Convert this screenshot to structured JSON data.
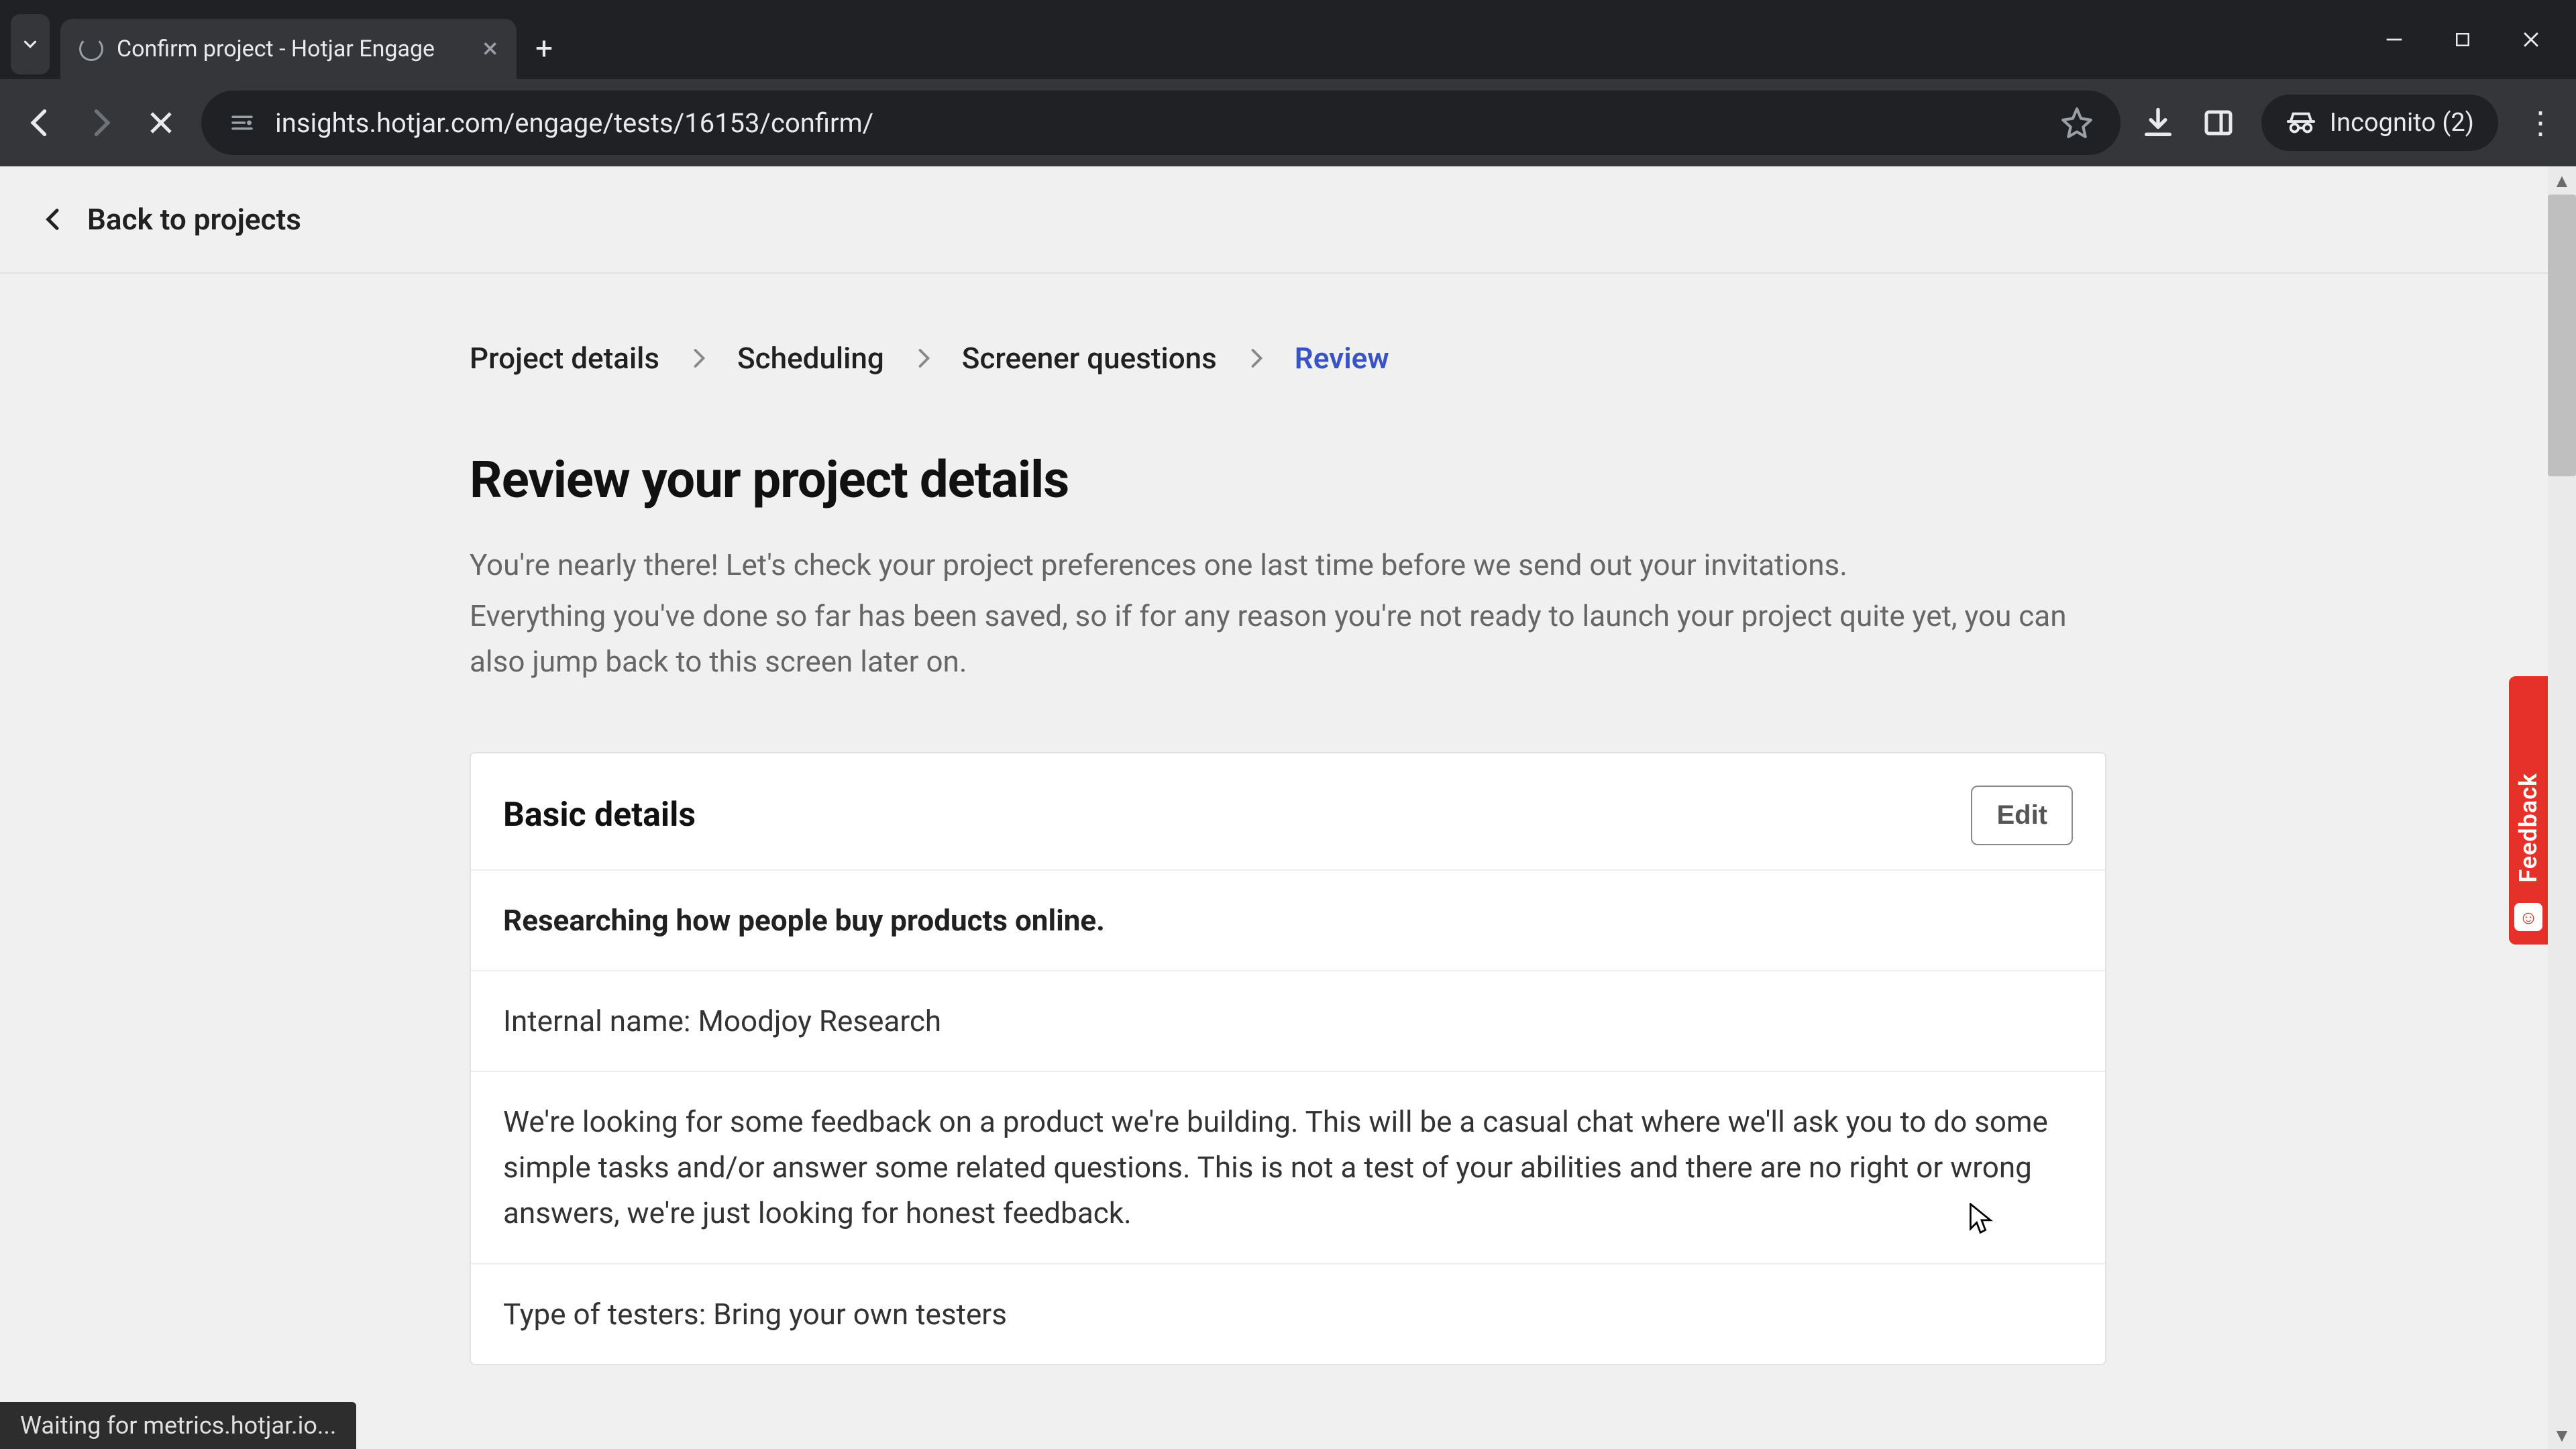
{
  "browser": {
    "tab_title": "Confirm project - Hotjar Engage",
    "url": "insights.hotjar.com/engage/tests/16153/confirm/",
    "incognito_label": "Incognito (2)",
    "status_text": "Waiting for metrics.hotjar.io..."
  },
  "back_link": "Back to projects",
  "breadcrumb": {
    "items": [
      "Project details",
      "Scheduling",
      "Screener questions",
      "Review"
    ],
    "active_index": 3
  },
  "page": {
    "title": "Review your project details",
    "intro_1": "You're nearly there! Let's check your project preferences one last time before we send out your invitations.",
    "intro_2": "Everything you've done so far has been saved, so if for any reason you're not ready to launch your project quite yet, you can also jump back to this screen later on."
  },
  "basic_details": {
    "section_title": "Basic details",
    "edit_label": "Edit",
    "project_title": "Researching how people buy products online.",
    "internal_name": "Internal name: Moodjoy Research",
    "description": "We're looking for some feedback on a product we're building. This will be a casual chat where we'll ask you to do some simple tasks and/or answer some related questions. This is not a test of your abilities and there are no right or wrong answers, we're just looking for honest feedback.",
    "tester_type": "Type of testers: Bring your own testers"
  },
  "feedback_tab_label": "Feedback"
}
